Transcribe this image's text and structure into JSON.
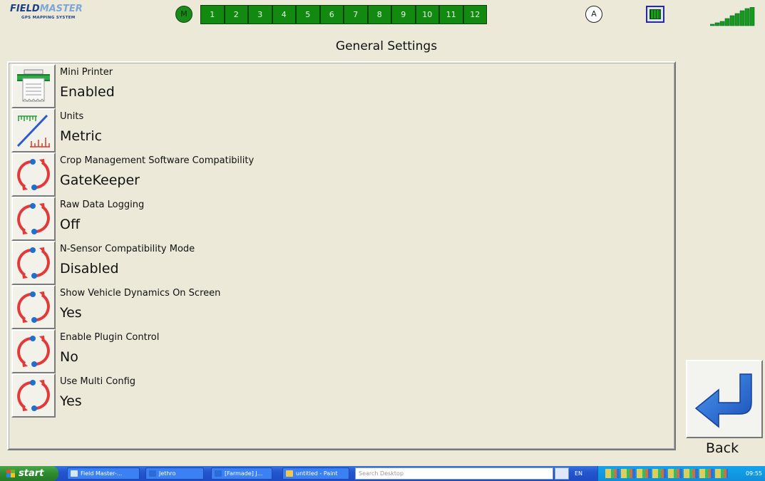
{
  "topbar": {
    "logo_text_dark": "FIELD",
    "logo_text_light": "MASTER",
    "logo_tagline": "GPS MAPPING SYSTEM",
    "mode_manual": "M",
    "sections": [
      "1",
      "2",
      "3",
      "4",
      "5",
      "6",
      "7",
      "8",
      "9",
      "10",
      "11",
      "12"
    ],
    "mode_auto": "A",
    "section_color": "#128a12"
  },
  "page": {
    "title": "General Settings"
  },
  "settings": [
    {
      "label": "Mini Printer",
      "value": "Enabled",
      "icon": "printer-icon"
    },
    {
      "label": "Units",
      "value": "Metric",
      "icon": "units-icon"
    },
    {
      "label": "Crop Management Software Compatibility",
      "value": "GateKeeper",
      "icon": "cycle-icon"
    },
    {
      "label": "Raw Data Logging",
      "value": "Off",
      "icon": "cycle-icon"
    },
    {
      "label": "N-Sensor Compatibility Mode",
      "value": "Disabled",
      "icon": "cycle-icon"
    },
    {
      "label": "Show Vehicle Dynamics On Screen",
      "value": "Yes",
      "icon": "cycle-icon"
    },
    {
      "label": "Enable Plugin Control",
      "value": "No",
      "icon": "cycle-icon"
    },
    {
      "label": "Use Multi Config",
      "value": "Yes",
      "icon": "cycle-icon"
    }
  ],
  "back": {
    "label": "Back",
    "icon": "return-arrow-icon"
  },
  "taskbar": {
    "start": "start",
    "tasks": [
      "Field Master-...",
      "Jethro",
      "[Farmade] J...",
      "untitled - Paint"
    ],
    "search_placeholder": "Search Desktop",
    "lang": "EN",
    "clock": "09:55"
  }
}
